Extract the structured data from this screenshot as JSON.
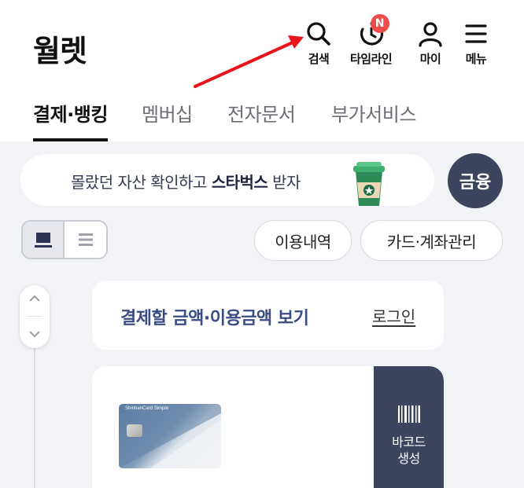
{
  "header": {
    "title": "월렛",
    "actions": [
      {
        "label": "검색",
        "icon": "search-icon"
      },
      {
        "label": "타임라인",
        "icon": "timeline-icon",
        "badge": "N"
      },
      {
        "label": "마이",
        "icon": "person-icon"
      },
      {
        "label": "메뉴",
        "icon": "hamburger-icon"
      }
    ]
  },
  "tabs": [
    {
      "label": "결제·뱅킹",
      "active": true
    },
    {
      "label": "멤버십",
      "active": false
    },
    {
      "label": "전자문서",
      "active": false
    },
    {
      "label": "부가서비스",
      "active": false
    }
  ],
  "promo": {
    "text_before": "몰랐던 자산 확인하고 ",
    "text_bold": "스타벅스",
    "text_after": " 받자",
    "icon": "coffee-cup-icon"
  },
  "finance_button": {
    "label": "금융"
  },
  "actions": {
    "usage_history": "이용내역",
    "card_account_manage": "카드·계좌관리"
  },
  "login_card": {
    "title": "결제할 금액·이용금액 보기",
    "link": "로그인"
  },
  "card": {
    "brand_text": "ShinhanCard Simple",
    "barcode_label_line1": "바코드",
    "barcode_label_line2": "생성"
  },
  "colors": {
    "accent_dark": "#3d4460",
    "badge_red": "#f04b4b",
    "annotation_arrow": "#e8141b"
  }
}
